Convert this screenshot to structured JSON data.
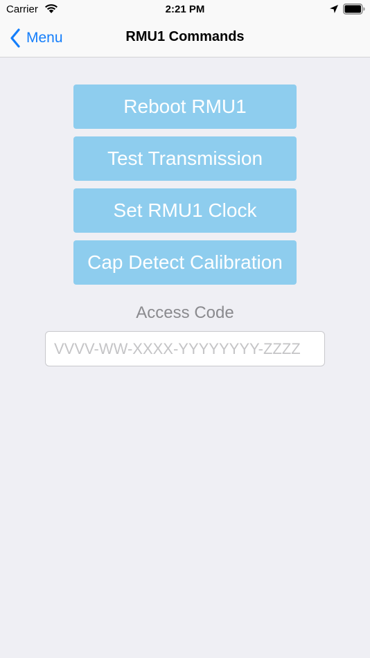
{
  "status_bar": {
    "carrier": "Carrier",
    "time": "2:21 PM",
    "wifi_icon": "wifi-icon",
    "location_icon": "location-arrow-icon",
    "battery_icon": "battery-full-icon"
  },
  "nav": {
    "back_label": "Menu",
    "back_icon": "chevron-left-icon",
    "title": "RMU1 Commands"
  },
  "commands": {
    "reboot": "Reboot RMU1",
    "test_transmission": "Test Transmission",
    "set_clock": "Set RMU1 Clock",
    "cap_detect": "Cap Detect Calibration"
  },
  "access": {
    "label": "Access Code",
    "value": "",
    "placeholder": "VVVV-WW-XXXX-YYYYYYYY-ZZZZ"
  },
  "colors": {
    "accent": "#147efb",
    "button_bg": "#8ecdee",
    "button_text": "#ffffff",
    "background": "#efeff4",
    "label_text": "#8a8a8e"
  }
}
